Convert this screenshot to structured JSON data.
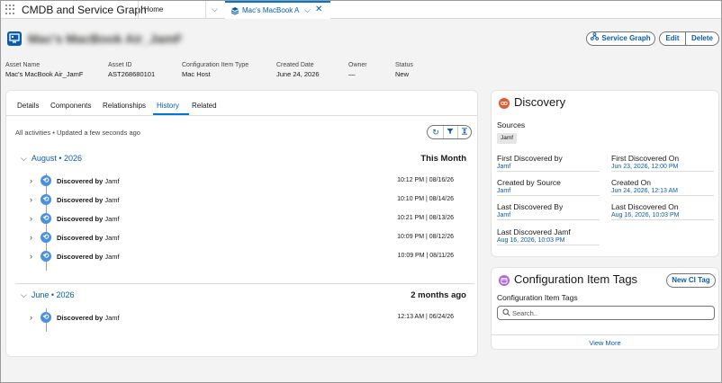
{
  "nav": {
    "app_name": "CMDB and Service Graph",
    "home_label": "Home",
    "record_tab_label": "Mac's MacBook A..."
  },
  "record": {
    "title": "Mac's MacBook Air_JamF",
    "buttons": {
      "service_graph": "Service Graph",
      "edit": "Edit",
      "delete": "Delete"
    }
  },
  "highlights": [
    {
      "label": "Asset Name",
      "value": "Mac's MacBook Air_JamF"
    },
    {
      "label": "Asset ID",
      "value": "AST268680101"
    },
    {
      "label": "Configuration Item Type",
      "value": "Mac Host"
    },
    {
      "label": "Created Date",
      "value": "June 24, 2026"
    },
    {
      "label": "Owner",
      "value": "—"
    },
    {
      "label": "Status",
      "value": "New"
    }
  ],
  "tabs": [
    "Details",
    "Components",
    "Relationships",
    "History",
    "Related"
  ],
  "history": {
    "activity_note": "All activities • Updated a few seconds ago",
    "groups": [
      {
        "title": "August • 2026",
        "relative": "This Month",
        "events": [
          {
            "action": "Discovered by",
            "source": "Jamf",
            "time": "10:12 PM | 08/16/26"
          },
          {
            "action": "Discovered by",
            "source": "Jamf",
            "time": "10:10 PM | 08/14/26"
          },
          {
            "action": "Discovered by",
            "source": "Jamf",
            "time": "10:21 PM | 08/13/26"
          },
          {
            "action": "Discovered by",
            "source": "Jamf",
            "time": "10:09 PM | 08/12/26"
          },
          {
            "action": "Discovered by",
            "source": "Jamf",
            "time": "10:09 PM | 08/11/26"
          }
        ]
      },
      {
        "title": "June • 2026",
        "relative": "2 months ago",
        "events": [
          {
            "action": "Discovered by",
            "source": "Jamf",
            "time": "12:13 AM | 06/24/26"
          }
        ]
      }
    ]
  },
  "discovery": {
    "title": "Discovery",
    "sources_label": "Sources",
    "source_pill": "Jamf",
    "fields": [
      {
        "label": "First Discovered by",
        "value": "Jamf"
      },
      {
        "label": "First Discovered On",
        "value": "Jun 23, 2026, 12:00 PM"
      },
      {
        "label": "Created by Source",
        "value": "Jamf"
      },
      {
        "label": "Created On",
        "value": "Jun 24, 2026, 12:13 AM"
      },
      {
        "label": "Last Discovered By",
        "value": "Jamf"
      },
      {
        "label": "Last Discovered On",
        "value": "Aug 16, 2026, 10:03 PM"
      },
      {
        "label": "Last Discovered Jamf",
        "value": "Aug 16, 2026, 10:03 PM"
      }
    ]
  },
  "tags": {
    "title": "Configuration Item Tags",
    "new_button": "New CI Tag",
    "field_label": "Configuration Item Tags",
    "search_placeholder": "Search..",
    "view_more": "View More"
  },
  "colors": {
    "brand_blue": "#0b5cab",
    "accent_blue": "#0176d3",
    "discovery_icon": "#e8572b",
    "tags_icon": "#b366d6",
    "event_icon": "#4a90e2"
  }
}
